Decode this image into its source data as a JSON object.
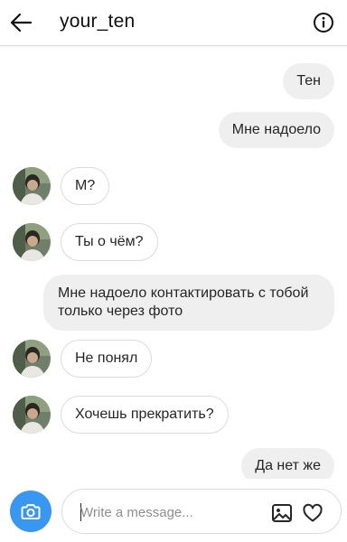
{
  "header": {
    "title": "your_ten"
  },
  "messages": [
    {
      "from": "me",
      "text": "Тен"
    },
    {
      "from": "me",
      "text": "Мне надоело"
    },
    {
      "from": "them",
      "text": "М?"
    },
    {
      "from": "them",
      "text": "Ты о чём?"
    },
    {
      "from": "me",
      "text": "Мне надоело контактировать с тобой только через фото"
    },
    {
      "from": "them",
      "text": "Не понял"
    },
    {
      "from": "them",
      "text": "Хочешь прекратить?"
    },
    {
      "from": "me",
      "text": "Да нет же"
    }
  ],
  "composer": {
    "placeholder": "Write a message..."
  },
  "colors": {
    "accent": "#3897f0",
    "outgoing_bubble": "#efefef",
    "border": "#dbdbdb"
  },
  "icons": {
    "back": "arrow-left-icon",
    "info": "info-icon",
    "camera": "camera-icon",
    "gallery": "image-icon",
    "like": "heart-icon"
  }
}
